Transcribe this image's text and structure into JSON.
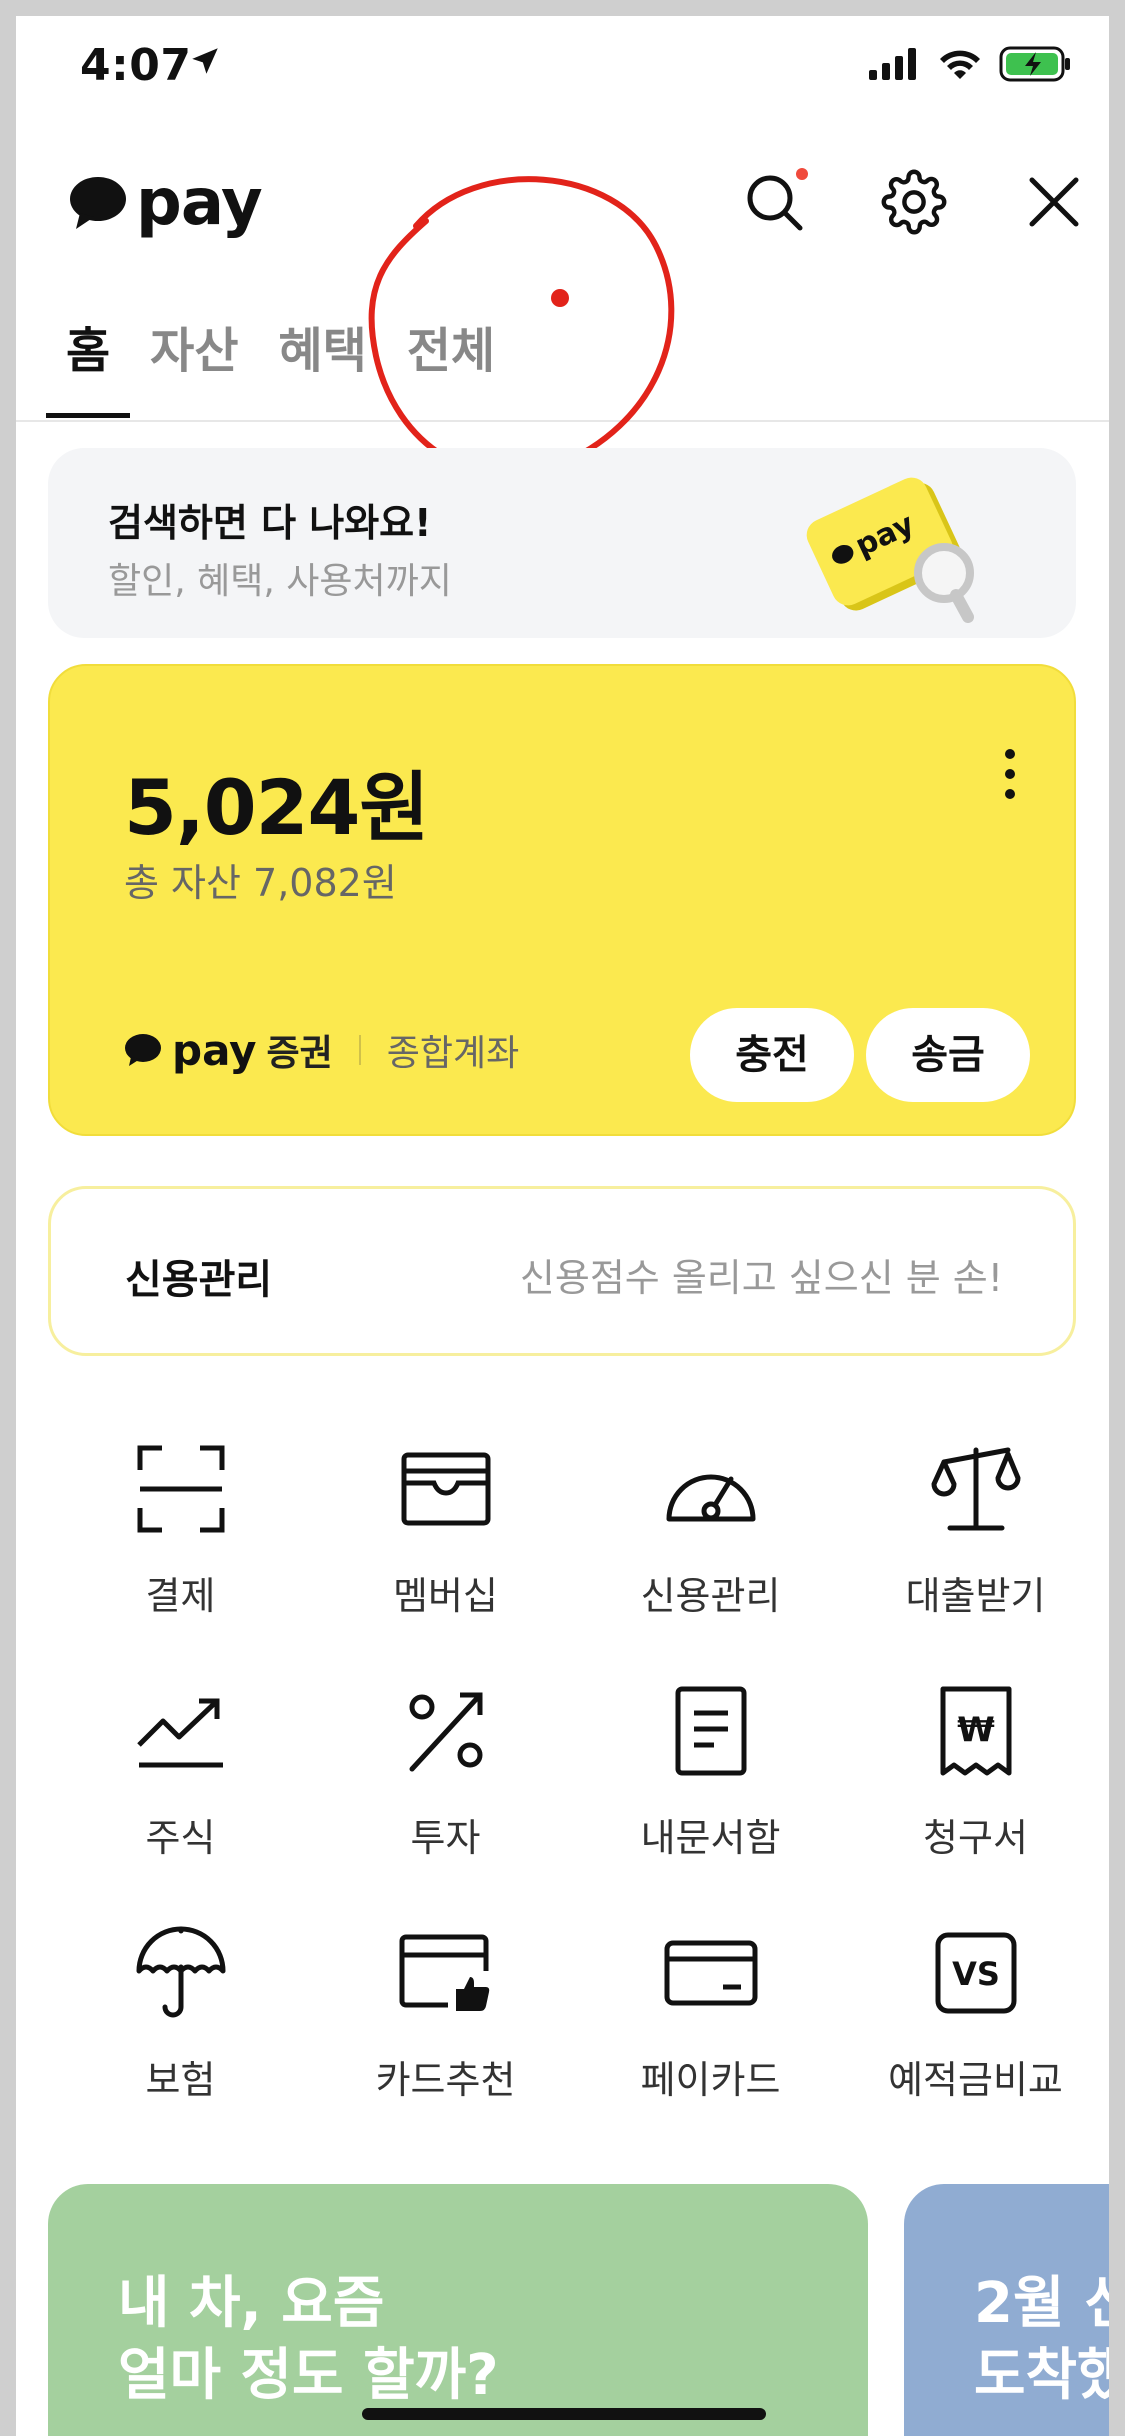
{
  "status_bar": {
    "time": "4:07"
  },
  "header": {
    "brand": "pay"
  },
  "tabs": [
    {
      "label": "홈",
      "active": true
    },
    {
      "label": "자산",
      "active": false
    },
    {
      "label": "혜택",
      "active": false
    },
    {
      "label": "전체",
      "active": false
    }
  ],
  "search_banner": {
    "title": "검색하면 다 나와요!",
    "subtitle": "할인, 혜택, 사용처까지",
    "art_text": "pay"
  },
  "balance_card": {
    "amount": "5,024원",
    "total": "총 자산 7,082원",
    "account_brand": "pay",
    "account_brand_suffix": "증권",
    "account_type": "종합계좌",
    "charge_label": "충전",
    "send_label": "송금"
  },
  "credit_bar": {
    "label": "신용관리",
    "message": "신용점수 올리고 싶으신 분 손!"
  },
  "menu_grid": [
    {
      "label": "결제",
      "icon": "scan-icon"
    },
    {
      "label": "멤버십",
      "icon": "wallet-icon"
    },
    {
      "label": "신용관리",
      "icon": "gauge-icon"
    },
    {
      "label": "대출받기",
      "icon": "scale-icon"
    },
    {
      "label": "주식",
      "icon": "trend-icon"
    },
    {
      "label": "투자",
      "icon": "percent-icon"
    },
    {
      "label": "내문서함",
      "icon": "document-icon"
    },
    {
      "label": "청구서",
      "icon": "bill-icon"
    },
    {
      "label": "보험",
      "icon": "umbrella-icon"
    },
    {
      "label": "카드추천",
      "icon": "card-thumb-icon"
    },
    {
      "label": "페이카드",
      "icon": "card-icon"
    },
    {
      "label": "예적금비교",
      "icon": "vs-icon"
    }
  ],
  "promos": [
    {
      "line1": "내 차, 요즘",
      "line2": "얼마 정도 할까?",
      "color": "#a4d09e"
    },
    {
      "line1": "2월 신",
      "line2": "도착했",
      "color": "#90acd2"
    }
  ],
  "colors": {
    "accent": "#fbe94f",
    "annotation": "#e2231a"
  }
}
